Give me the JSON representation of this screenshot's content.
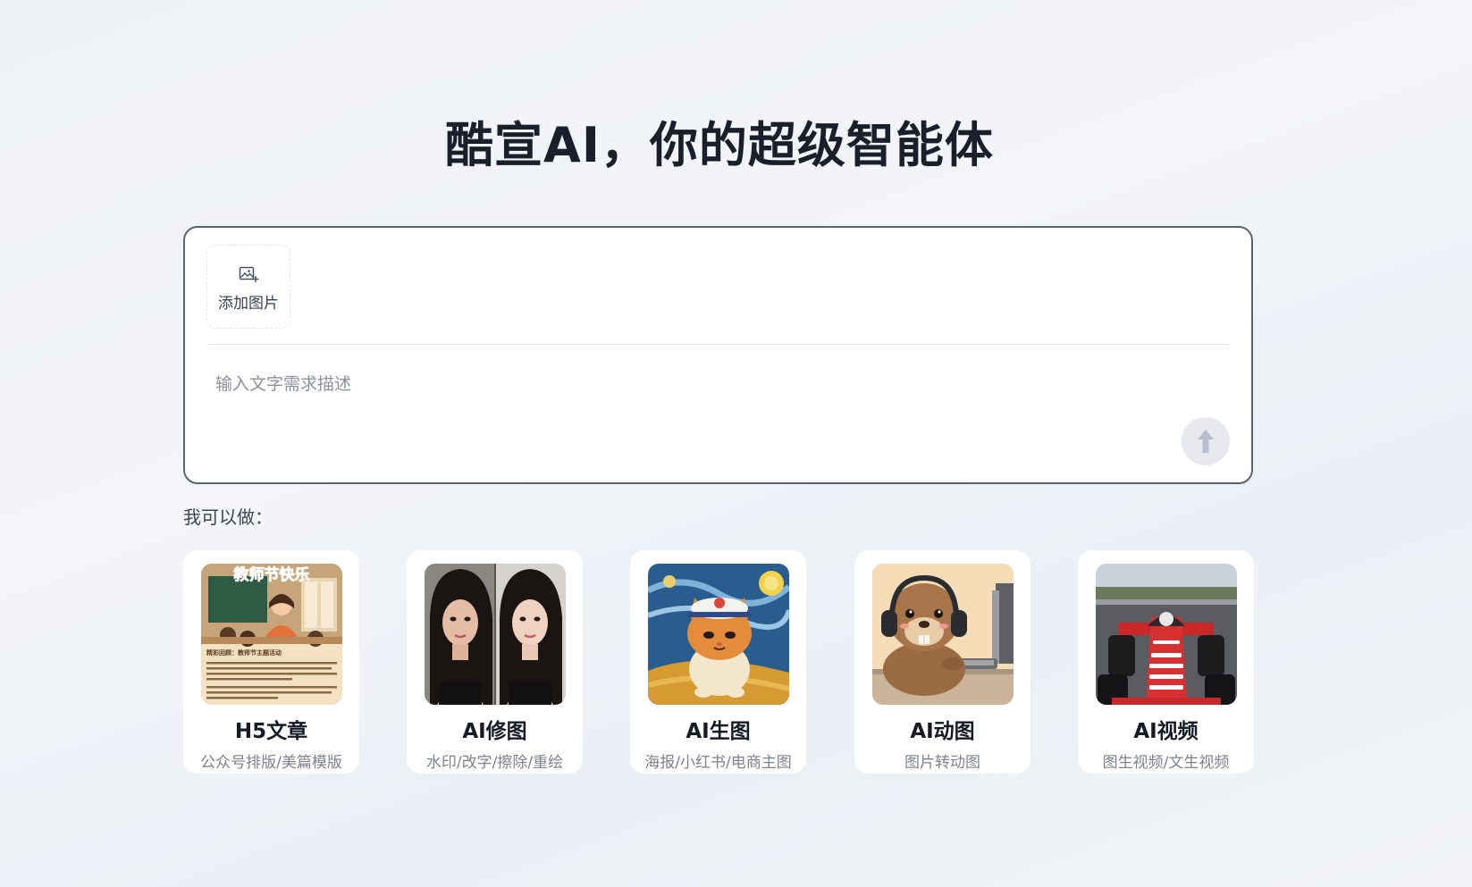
{
  "headline": "酷宣AI，你的超级智能体",
  "composer": {
    "add_image_label": "添加图片",
    "prompt_placeholder": "输入文字需求描述"
  },
  "capabilities": {
    "heading": "我可以做：",
    "cards": [
      {
        "title": "H5文章",
        "subtitle": "公众号排版/美篇模版",
        "thumb": "teachers-day-article",
        "thumb_banner": "教师节快乐",
        "thumb_caption": "精彩回顾：教师节主题活动"
      },
      {
        "title": "AI修图",
        "subtitle": "水印/改字/擦除/重绘",
        "thumb": "portrait-retouch"
      },
      {
        "title": "AI生图",
        "subtitle": "海报/小红书/电商主图",
        "thumb": "starry-night-cat"
      },
      {
        "title": "AI动图",
        "subtitle": "图片转动图",
        "thumb": "beaver-with-headphones"
      },
      {
        "title": "AI视频",
        "subtitle": "图生视频/文生视频",
        "thumb": "race-car"
      }
    ]
  },
  "colors": {
    "headline": "#1a1f2b",
    "composer_border": "#5b6270",
    "send_button": "#e7e9ef",
    "send_arrow": "#b7bdca"
  }
}
